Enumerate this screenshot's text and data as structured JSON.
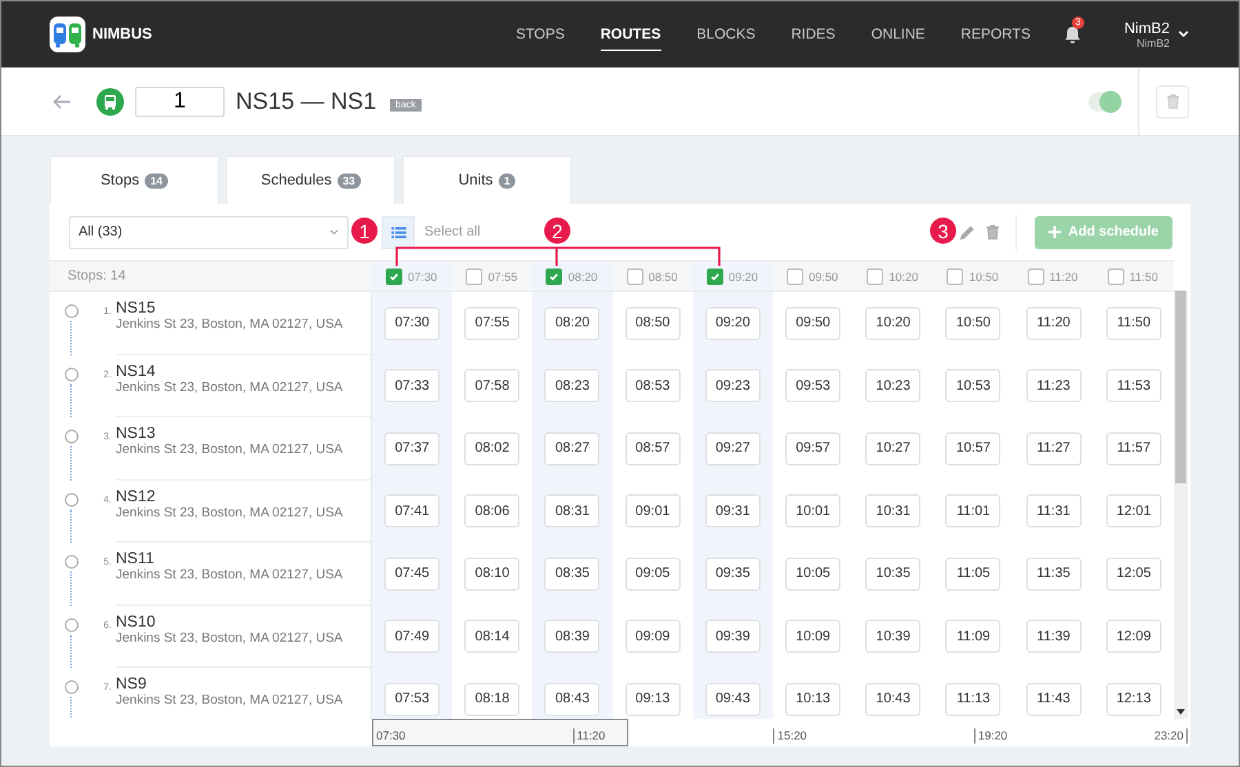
{
  "app": {
    "name": "NIMBUS"
  },
  "nav": [
    {
      "label": "STOPS",
      "selected": false
    },
    {
      "label": "ROUTES",
      "selected": true
    },
    {
      "label": "BLOCKS",
      "selected": false
    },
    {
      "label": "RIDES",
      "selected": false
    },
    {
      "label": "ONLINE",
      "selected": false
    },
    {
      "label": "REPORTS",
      "selected": false
    }
  ],
  "notifications": {
    "count": "3"
  },
  "user": {
    "name": "NimB2",
    "account": "NimB2"
  },
  "route": {
    "number": "1",
    "title": "NS15 — NS1",
    "badge": "back",
    "active": true
  },
  "tabs": [
    {
      "label": "Stops",
      "count": "14"
    },
    {
      "label": "Schedules",
      "count": "33"
    },
    {
      "label": "Units",
      "count": "1"
    }
  ],
  "toolbar": {
    "filter": "All (33)",
    "select_all": "Select all",
    "add_button": {
      "label": "Add schedule",
      "disabled": true
    }
  },
  "callouts": [
    "1",
    "2",
    "3"
  ],
  "stops_header": "Stops: 14",
  "schedules": [
    {
      "time": "07:30",
      "checked": true
    },
    {
      "time": "07:55",
      "checked": false
    },
    {
      "time": "08:20",
      "checked": true
    },
    {
      "time": "08:50",
      "checked": false
    },
    {
      "time": "09:20",
      "checked": true
    },
    {
      "time": "09:50",
      "checked": false
    },
    {
      "time": "10:20",
      "checked": false
    },
    {
      "time": "10:50",
      "checked": false
    },
    {
      "time": "11:20",
      "checked": false
    },
    {
      "time": "11:50",
      "checked": false
    }
  ],
  "stops": [
    {
      "number": "1.",
      "name": "NS15",
      "address": "Jenkins St 23, Boston, MA 02127, USA",
      "times": [
        "07:30",
        "07:55",
        "08:20",
        "08:50",
        "09:20",
        "09:50",
        "10:20",
        "10:50",
        "11:20",
        "11:50"
      ]
    },
    {
      "number": "2.",
      "name": "NS14",
      "address": "Jenkins St 23, Boston, MA 02127, USA",
      "times": [
        "07:33",
        "07:58",
        "08:23",
        "08:53",
        "09:23",
        "09:53",
        "10:23",
        "10:53",
        "11:23",
        "11:53"
      ]
    },
    {
      "number": "3.",
      "name": "NS13",
      "address": "Jenkins St 23, Boston, MA 02127, USA",
      "times": [
        "07:37",
        "08:02",
        "08:27",
        "08:57",
        "09:27",
        "09:57",
        "10:27",
        "10:57",
        "11:27",
        "11:57"
      ]
    },
    {
      "number": "4.",
      "name": "NS12",
      "address": "Jenkins St 23, Boston, MA 02127, USA",
      "times": [
        "07:41",
        "08:06",
        "08:31",
        "09:01",
        "09:31",
        "10:01",
        "10:31",
        "11:01",
        "11:31",
        "12:01"
      ]
    },
    {
      "number": "5.",
      "name": "NS11",
      "address": "Jenkins St 23, Boston, MA 02127, USA",
      "times": [
        "07:45",
        "08:10",
        "08:35",
        "09:05",
        "09:35",
        "10:05",
        "10:35",
        "11:05",
        "11:35",
        "12:05"
      ]
    },
    {
      "number": "6.",
      "name": "NS10",
      "address": "Jenkins St 23, Boston, MA 02127, USA",
      "times": [
        "07:49",
        "08:14",
        "08:39",
        "09:09",
        "09:39",
        "10:09",
        "10:39",
        "11:09",
        "11:39",
        "12:09"
      ]
    },
    {
      "number": "7.",
      "name": "NS9",
      "address": "Jenkins St 23, Boston, MA 02127, USA",
      "times": [
        "07:53",
        "08:18",
        "08:43",
        "09:13",
        "09:43",
        "10:13",
        "10:43",
        "11:13",
        "11:43",
        "12:13"
      ]
    }
  ],
  "timeline": {
    "labels": [
      "07:30",
      "11:20",
      "15:20",
      "19:20",
      "23:20"
    ],
    "level": 0.31
  }
}
